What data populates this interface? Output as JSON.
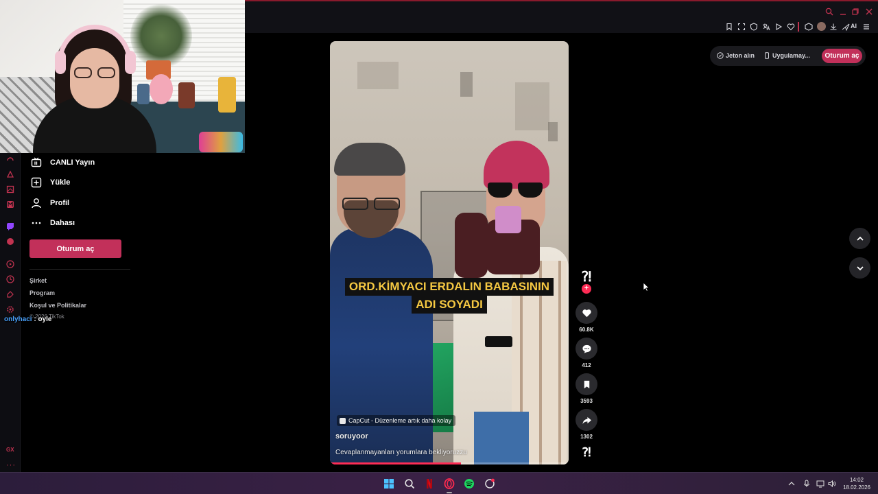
{
  "browser": {
    "ai_label": "AI",
    "accent_color": "#c23350"
  },
  "sidebar": {
    "items": [
      {
        "label": "CANLI Yayın",
        "icon": "live-tv-icon"
      },
      {
        "label": "Yükle",
        "icon": "upload-plus-icon"
      },
      {
        "label": "Profil",
        "icon": "user-icon"
      },
      {
        "label": "Dahası",
        "icon": "more-dots-icon"
      }
    ],
    "login_label": "Oturum aç",
    "footer_links": [
      "Şirket",
      "Program",
      "Koşul ve Politikalar"
    ],
    "copyright": "© 2026 TikTok"
  },
  "chat": {
    "user": "onlyhaci",
    "separator": ":",
    "message": "oyle"
  },
  "video": {
    "caption_line1": "ORD.KİMYACI ERDALIN BABASININ",
    "caption_line2": "ADI SOYADI",
    "capcut_text": "CapCut - Düzenleme artık daha kolay",
    "author": "soruyoor",
    "description": "Cevaplanmayanları yorumlara bekliyoruzzu",
    "progress_fraction": 0.55
  },
  "actions": {
    "avatar_glyph": "⁈",
    "follow_glyph": "+",
    "likes": "60.8K",
    "comments": "412",
    "saves": "3593",
    "shares": "1302",
    "music_glyph": "⁈"
  },
  "top_actions": {
    "coins": "Jeton alın",
    "app": "Uygulamay...",
    "login": "Oturum aç"
  },
  "taskbar": {
    "time": "14:02",
    "date": "18.02.2026"
  }
}
